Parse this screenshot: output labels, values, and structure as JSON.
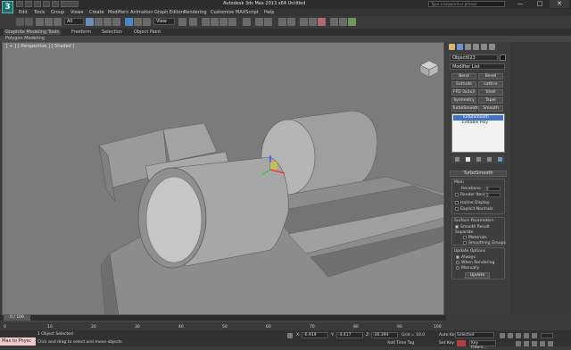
{
  "app": {
    "logo_glyph": "3",
    "title": "Autodesk 3ds Max 2013 x64   Untitled",
    "search_placeholder": "Type a keyword or phrase",
    "window_controls": [
      "—",
      "□",
      "✕"
    ]
  },
  "menu": [
    "Edit",
    "Tools",
    "Group",
    "Views",
    "Create",
    "Modifiers",
    "Animation",
    "Graph Editors",
    "Rendering",
    "Customize",
    "MAXScript",
    "Help"
  ],
  "toolbar": {
    "selection_filter": "All",
    "reference_coord": "View"
  },
  "ribbon": {
    "tabs": [
      "Graphite Modeling Tools",
      "Freeform",
      "Selection",
      "Object Paint"
    ],
    "subtab": "Polygon Modeling"
  },
  "viewport": {
    "label": "[ + ] [ Perspective ] [ Shaded ]",
    "background_color": "#7b7b7b"
  },
  "command_panel": {
    "object_name": "Object023",
    "modifier_list": "Modifier List",
    "modifier_buttons": [
      "Bend",
      "Bevel",
      "Extrude",
      "Lattice",
      "FFD 3x3x3",
      "Shell",
      "Symmetry",
      "Taper",
      "TurboSmooth",
      "Smooth"
    ],
    "stack": [
      {
        "label": "TurboSmooth",
        "selected": true
      },
      {
        "label": "Editable Poly",
        "selected": false
      }
    ],
    "rollout_title": "TurboSmooth",
    "main": {
      "group_label": "Main",
      "iterations_label": "Iterations:",
      "iterations_value": "0",
      "render_iters_label": "Render Iters:",
      "render_iters_value": "0",
      "isoline_label": "Isoline Display",
      "explicit_normals_label": "Explicit Normals"
    },
    "surface": {
      "group_label": "Surface Parameters",
      "smooth_result_label": "Smooth Result",
      "separate_label": "Separate",
      "materials_label": "Materials",
      "smoothing_groups_label": "Smoothing Groups"
    },
    "update": {
      "group_label": "Update Options",
      "always_label": "Always",
      "when_rendering_label": "When Rendering",
      "manually_label": "Manually",
      "update_button": "Update"
    }
  },
  "timeline": {
    "frame_label": "0 / 100",
    "ticks": [
      "0",
      "10",
      "20",
      "30",
      "40",
      "50",
      "60",
      "70",
      "80",
      "90",
      "100"
    ]
  },
  "status": {
    "maxscript": "Max to Physc",
    "line1": "1 Object Selected",
    "line2": "Click and drag to select and move objects",
    "x_label": "X:",
    "x_value": "-6.919",
    "y_label": "Y:",
    "y_value": "-4.417",
    "z_label": "Z:",
    "z_value": "-36.394",
    "grid_label": "Grid = 10.0",
    "add_time_tag": "Add Time Tag",
    "auto_key": "Auto Key",
    "set_key": "Set Key",
    "selected": "Selected",
    "key_filters": "Key Filters..."
  }
}
